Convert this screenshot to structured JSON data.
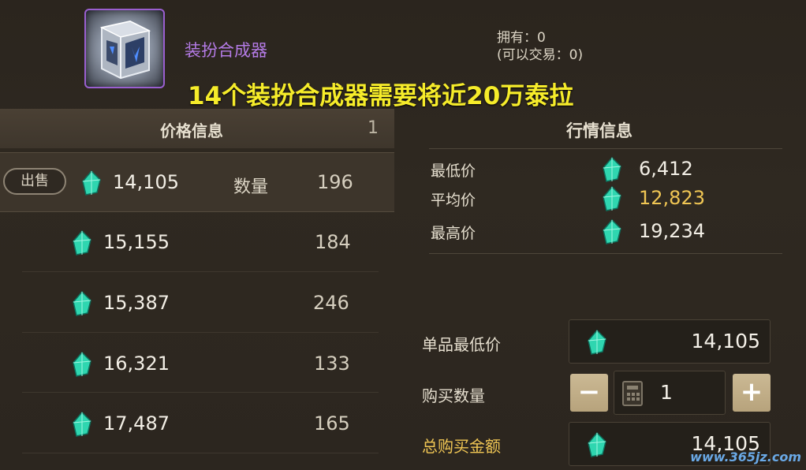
{
  "item": {
    "name": "装扮合成器",
    "owned_text": "拥有：0",
    "tradable_text": "(可以交易：0)"
  },
  "headline": "14个装扮合成器需要将近20万泰拉",
  "price_info": {
    "title": "价格信息",
    "page": "1",
    "sell_button": "出售",
    "quantity_label": "数量",
    "listings": [
      {
        "price": "14,105",
        "count": "196"
      },
      {
        "price": "15,155",
        "count": "184"
      },
      {
        "price": "15,387",
        "count": "246"
      },
      {
        "price": "16,321",
        "count": "133"
      },
      {
        "price": "17,487",
        "count": "165"
      }
    ]
  },
  "market": {
    "title": "行情信息",
    "rows": [
      {
        "label": "最低价",
        "value": "6,412"
      },
      {
        "label": "平均价",
        "value": "12,823"
      },
      {
        "label": "最高价",
        "value": "19,234"
      }
    ]
  },
  "purchase": {
    "unit_price_label": "单品最低价",
    "unit_price_value": "14,105",
    "quantity_label": "购买数量",
    "quantity_value": "1",
    "minus_label": "−",
    "plus_label": "+",
    "total_label": "总购买金额",
    "total_value": "14,105"
  },
  "watermark": "www.365jz.com",
  "colors": {
    "accent_gold": "#f0c654",
    "item_purple": "#b47be6",
    "headline_yellow": "#f6ec2a",
    "gem": "#2fd6b0"
  },
  "icons": [
    "item-cube-icon",
    "gem-icon",
    "calculator-icon",
    "minus-icon",
    "plus-icon"
  ]
}
